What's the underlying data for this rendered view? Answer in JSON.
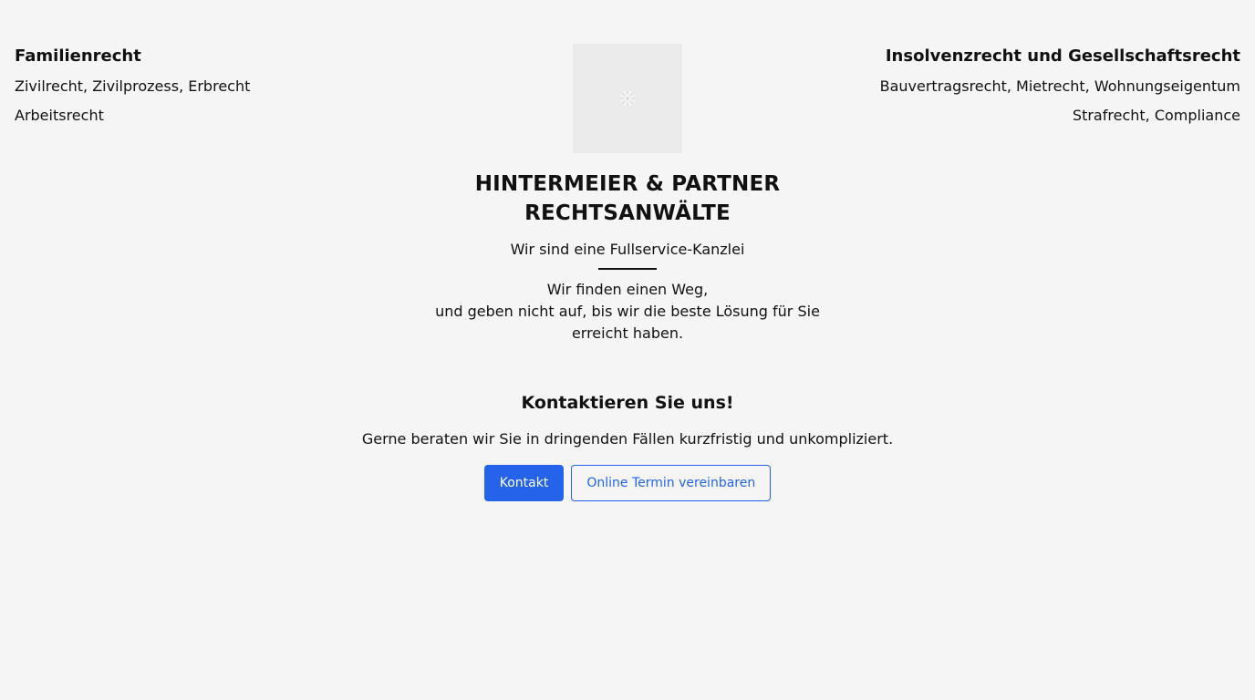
{
  "practice_areas": {
    "left": {
      "heading": "Familienrecht",
      "items": [
        "Zivilrecht, Zivilprozess, Erbrecht",
        "Arbeitsrecht"
      ]
    },
    "right": {
      "heading": "Insolvenzrecht und Gesellschaftsrecht",
      "items": [
        "Bauvertragsrecht, Mietrecht, Wohnungseigentum",
        "Strafrecht, Compliance"
      ]
    }
  },
  "hero": {
    "logo_icon": "loading-spinner-icon",
    "firm_name_line1": "HINTERMEIER & PARTNER",
    "firm_name_line2": "RECHTSANWÄLTE",
    "tagline": "Wir sind eine Fullservice-Kanzlei",
    "mission_line1": "Wir finden einen Weg,",
    "mission_line2": "und geben nicht auf, bis wir die beste Lösung für Sie",
    "mission_line3": "erreicht haben."
  },
  "contact": {
    "title": "Kontaktieren Sie uns!",
    "text": "Gerne beraten wir Sie in dringenden Fällen kurzfristig und unkompliziert.",
    "primary_button": "Kontakt",
    "secondary_button": "Online Termin vereinbaren"
  },
  "colors": {
    "background": "#f4f5f4",
    "accent": "#2563eb",
    "text": "#111111",
    "logo_placeholder": "#ebebeb"
  }
}
